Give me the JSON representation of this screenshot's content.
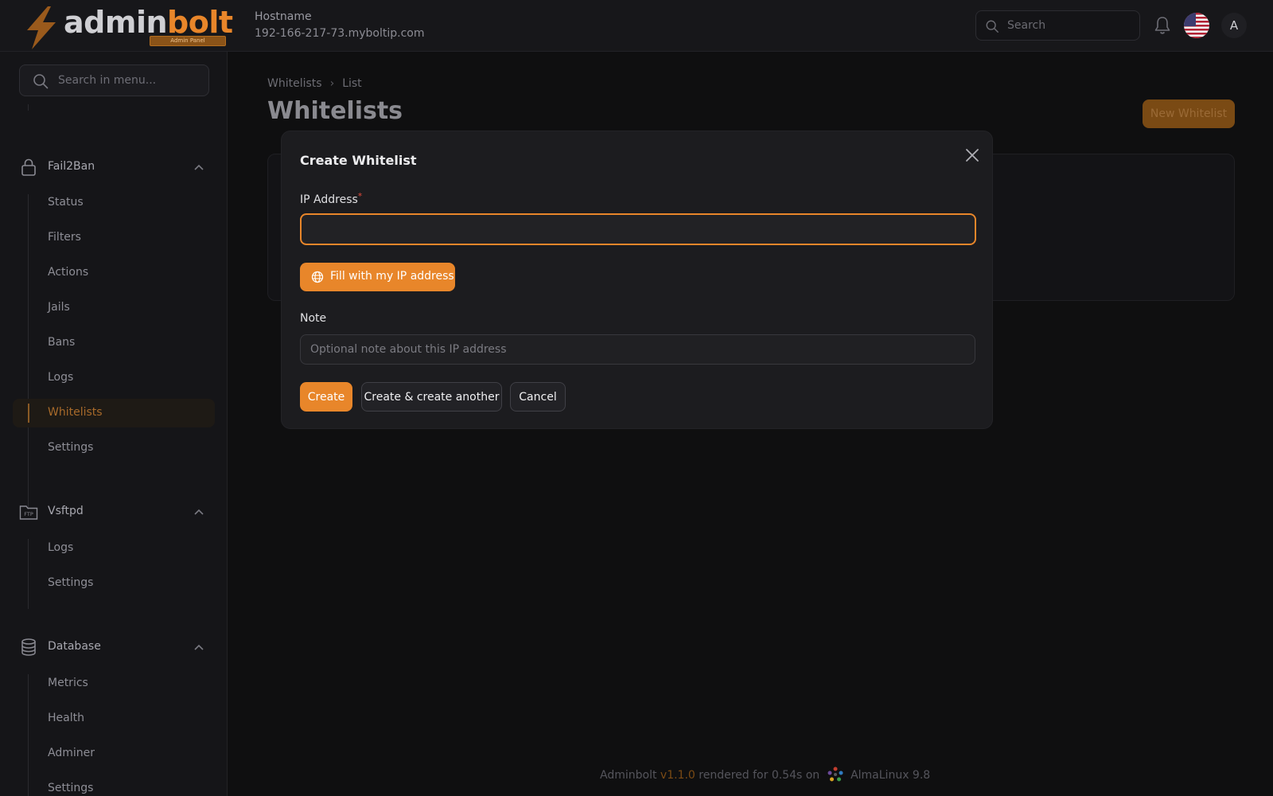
{
  "app": {
    "logo": {
      "part1": "admin",
      "part2": "bolt",
      "badge": "Admin Panel"
    },
    "hostname_label": "Hostname",
    "hostname_value": "192-166-217-73.myboltip.com",
    "search_placeholder": "Search",
    "avatar_initial": "A"
  },
  "sidebar": {
    "search_placeholder": "Search in menu...",
    "groups": [
      {
        "label": "Fail2Ban",
        "icon": "lock-icon",
        "items": [
          "Status",
          "Filters",
          "Actions",
          "Jails",
          "Bans",
          "Logs",
          "Whitelists",
          "Settings"
        ],
        "active": "Whitelists"
      },
      {
        "label": "Vsftpd",
        "icon": "ftp-folder-icon",
        "items": [
          "Logs",
          "Settings"
        ]
      },
      {
        "label": "Database",
        "icon": "database-icon",
        "items": [
          "Metrics",
          "Health",
          "Adminer",
          "Settings"
        ]
      }
    ]
  },
  "main": {
    "breadcrumb": [
      "Whitelists",
      "List"
    ],
    "title": "Whitelists",
    "new_button": "New Whitelist"
  },
  "modal": {
    "title": "Create Whitelist",
    "ip_label": "IP Address",
    "required_mark": "*",
    "ip_value": "",
    "fill_button": "Fill with my IP address",
    "note_label": "Note",
    "note_placeholder": "Optional note about this IP address",
    "create_button": "Create",
    "create_another_button": "Create & create another",
    "cancel_button": "Cancel"
  },
  "footer": {
    "app_name": "Adminbolt",
    "version": "v1.1.0",
    "rendered_text": "rendered for 0.54s on",
    "os": "AlmaLinux 9.8"
  },
  "colors": {
    "accent": "#e8862a",
    "background": "#0f0f10",
    "modal_bg": "#1c1c1f",
    "required": "#e14a3a"
  }
}
